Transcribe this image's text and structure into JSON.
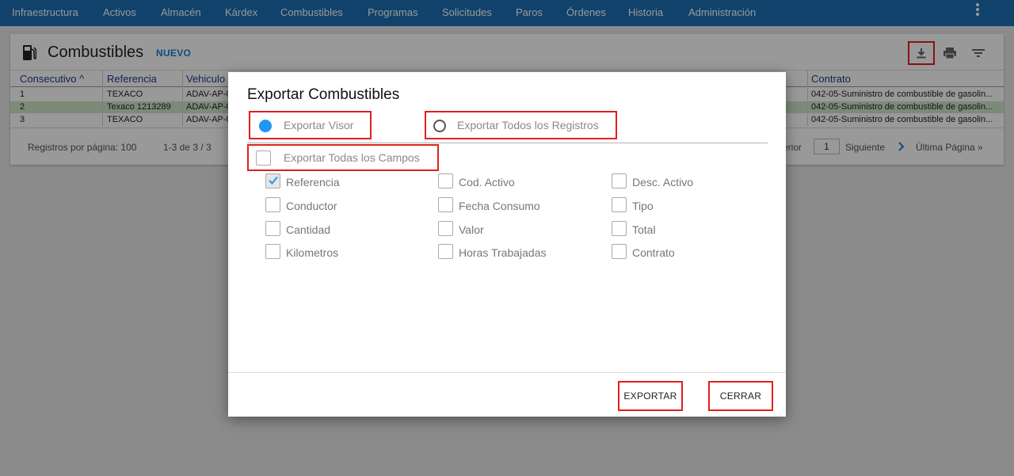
{
  "nav": {
    "items": [
      "Infraestructura",
      "Activos",
      "Almacén",
      "Kárdex",
      "Combustibles",
      "Programas",
      "Solicitudes",
      "Paros",
      "Órdenes",
      "Historia",
      "Administración"
    ]
  },
  "page": {
    "title": "Combustibles",
    "new_label": "NUEVO"
  },
  "grid": {
    "columns": [
      "Consecutivo",
      "Referencia",
      "Vehiculo",
      "Contrato"
    ],
    "rows": [
      {
        "consecutivo": "1",
        "referencia": "TEXACO",
        "vehiculo": "ADAV-AP-0",
        "contrato": "042-05-Suministro de combustible de gasolin..."
      },
      {
        "consecutivo": "2",
        "referencia": "Texaco 1213289",
        "vehiculo": "ADAV-AP-0",
        "contrato": "042-05-Suministro de combustible de gasolin..."
      },
      {
        "consecutivo": "3",
        "referencia": "TEXACO",
        "vehiculo": "ADAV-AP-0",
        "contrato": "042-05-Suministro de combustible de gasolin..."
      }
    ],
    "footer": {
      "per_page": "Registros por página: 100",
      "range": "1-3 de 3 / 3",
      "prev_fragment": "erior",
      "page": "1",
      "next": "Siguiente",
      "last": "Última Página »"
    }
  },
  "dialog": {
    "title": "Exportar Combustibles",
    "option_visor": "Exportar Visor",
    "option_all_records": "Exportar Todos los Registros",
    "option_all_fields": "Exportar Todas los Campos",
    "fields": [
      {
        "label": "Referencia",
        "checked": true
      },
      {
        "label": "Cod. Activo",
        "checked": false
      },
      {
        "label": "Desc. Activo",
        "checked": false
      },
      {
        "label": "Conductor",
        "checked": false
      },
      {
        "label": "Fecha Consumo",
        "checked": false
      },
      {
        "label": "Tipo",
        "checked": false
      },
      {
        "label": "Cantidad",
        "checked": false
      },
      {
        "label": "Valor",
        "checked": false
      },
      {
        "label": "Total",
        "checked": false
      },
      {
        "label": "Kilometros",
        "checked": false
      },
      {
        "label": "Horas Trabajadas",
        "checked": false
      },
      {
        "label": "Contrato",
        "checked": false
      }
    ],
    "export_label": "EXPORTAR",
    "close_label": "CERRAR"
  },
  "colors": {
    "nav_bg": "#1c6fb4",
    "accent": "#2196f3",
    "highlight_border": "#e02020",
    "selected_row": "#cfe8c8"
  }
}
